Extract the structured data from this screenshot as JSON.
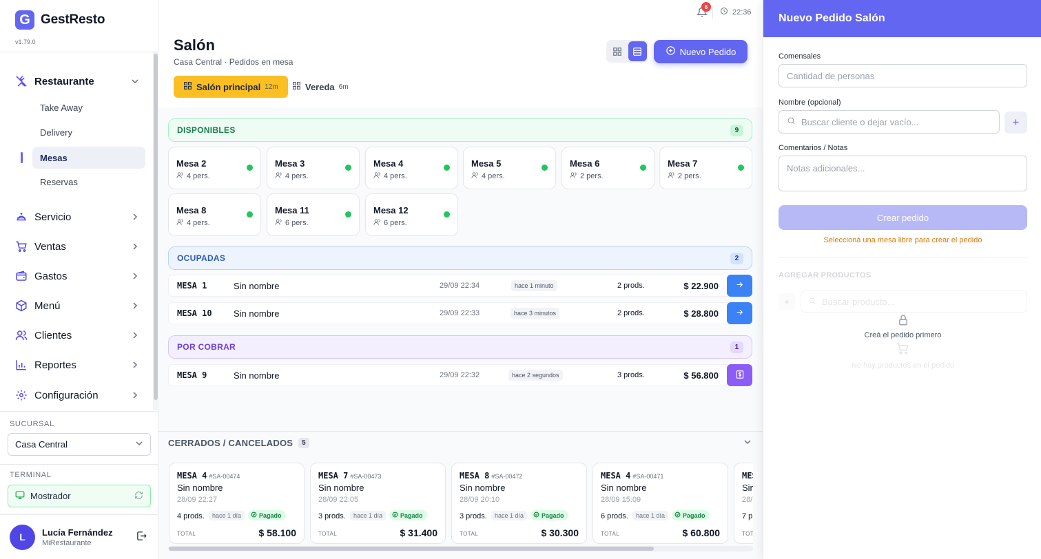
{
  "app": {
    "name": "GestResto",
    "logo_letter": "G",
    "version": "v1.79.0"
  },
  "sidebar": {
    "sections": [
      {
        "label": "Restaurante",
        "icon": "utensils-icon",
        "expanded": true,
        "children": [
          {
            "label": "Take Away",
            "active": false
          },
          {
            "label": "Delivery",
            "active": false
          },
          {
            "label": "Mesas",
            "active": true
          },
          {
            "label": "Reservas",
            "active": false
          }
        ]
      },
      {
        "label": "Servicio",
        "icon": "service-bell-icon"
      },
      {
        "label": "Ventas",
        "icon": "cart-icon"
      },
      {
        "label": "Gastos",
        "icon": "wallet-icon"
      },
      {
        "label": "Menú",
        "icon": "box-icon"
      },
      {
        "label": "Clientes",
        "icon": "users-icon"
      },
      {
        "label": "Reportes",
        "icon": "bar-chart-icon"
      },
      {
        "label": "Configuración",
        "icon": "gear-icon"
      }
    ],
    "branch_label": "SUCURSAL",
    "branch_value": "Casa Central",
    "terminal_label": "TERMINAL",
    "terminal_value": "Mostrador",
    "user": {
      "initial": "L",
      "name": "Lucía Fernández",
      "org": "MiRestaurante"
    }
  },
  "topbar": {
    "notifications": "6",
    "time": "22:36"
  },
  "header": {
    "title": "Salón",
    "subtitle": "Casa Central · Pedidos en mesa",
    "new_order_label": "Nuevo Pedido",
    "zones": [
      {
        "label": "Salón principal",
        "duration": "12m",
        "active": true
      },
      {
        "label": "Vereda",
        "duration": "6m",
        "active": false
      }
    ]
  },
  "available": {
    "title": "DISPONIBLES",
    "count": "9",
    "tables": [
      {
        "name": "Mesa 2",
        "people": "4 pers."
      },
      {
        "name": "Mesa 3",
        "people": "4 pers."
      },
      {
        "name": "Mesa 4",
        "people": "4 pers."
      },
      {
        "name": "Mesa 5",
        "people": "4 pers."
      },
      {
        "name": "Mesa 6",
        "people": "2 pers."
      },
      {
        "name": "Mesa 7",
        "people": "2 pers."
      },
      {
        "name": "Mesa 8",
        "people": "4 pers."
      },
      {
        "name": "Mesa 11",
        "people": "6 pers."
      },
      {
        "name": "Mesa 12",
        "people": "6 pers."
      }
    ]
  },
  "occupied": {
    "title": "OCUPADAS",
    "count": "2",
    "orders": [
      {
        "table": "MESA 1",
        "name": "Sin nombre",
        "date": "29/09 22:34",
        "ago": "hace 1 minuto",
        "products": "2 prods.",
        "total": "$ 22.900"
      },
      {
        "table": "MESA 10",
        "name": "Sin nombre",
        "date": "29/09 22:33",
        "ago": "hace 3 minutos",
        "products": "2 prods.",
        "total": "$ 28.800"
      }
    ]
  },
  "to_collect": {
    "title": "POR COBRAR",
    "count": "1",
    "orders": [
      {
        "table": "MESA 9",
        "name": "Sin nombre",
        "date": "29/09 22:32",
        "ago": "hace 2 segundos",
        "products": "3 prods.",
        "total": "$ 56.800"
      }
    ]
  },
  "closed": {
    "title": "CERRADOS / CANCELADOS",
    "count": "5",
    "total_label": "TOTAL",
    "orders": [
      {
        "table": "MESA 4",
        "ticket": "#SA-00474",
        "name": "Sin nombre",
        "date": "28/09 22:27",
        "products": "4 prods.",
        "ago": "hace 1 día",
        "status": "Pagado",
        "total": "$ 58.100"
      },
      {
        "table": "MESA 7",
        "ticket": "#SA-00473",
        "name": "Sin nombre",
        "date": "28/09 22:05",
        "products": "3 prods.",
        "ago": "hace 1 día",
        "status": "Pagado",
        "total": "$ 31.400"
      },
      {
        "table": "MESA 8",
        "ticket": "#SA-00472",
        "name": "Sin nombre",
        "date": "28/09 20:10",
        "products": "3 prods.",
        "ago": "hace 1 día",
        "status": "Pagado",
        "total": "$ 30.300"
      },
      {
        "table": "MESA 4",
        "ticket": "#SA-00471",
        "name": "Sin nombre",
        "date": "28/09 15:09",
        "products": "6 prods.",
        "ago": "hace 1 día",
        "status": "Pagado",
        "total": "$ 60.800"
      },
      {
        "table": "MES",
        "ticket": "",
        "name": "Sin",
        "date": "28/",
        "products": "7 p",
        "ago": "",
        "status": "",
        "total": ""
      }
    ]
  },
  "panel": {
    "title": "Nuevo Pedido Salón",
    "diners_label": "Comensales",
    "diners_placeholder": "Cantidad de personas",
    "name_label": "Nombre (opcional)",
    "name_placeholder": "Buscar cliente o dejar vacío...",
    "notes_label": "Comentarios / Notas",
    "notes_placeholder": "Notas adicionales...",
    "create_label": "Crear pedido",
    "warning": "Seleccioná una mesa libre para crear el pedido",
    "add_products_title": "AGREGAR PRODUCTOS",
    "product_search_placeholder": "Buscar producto...",
    "locked_text": "Creá el pedido primero",
    "empty_text": "No hay productos en el pedido"
  },
  "colors": {
    "accent": "#6366f1",
    "zone_active": "#fbbf24",
    "available": "#22c55e",
    "occupied_action": "#3b82f6",
    "collect_action": "#8b5cf6"
  }
}
